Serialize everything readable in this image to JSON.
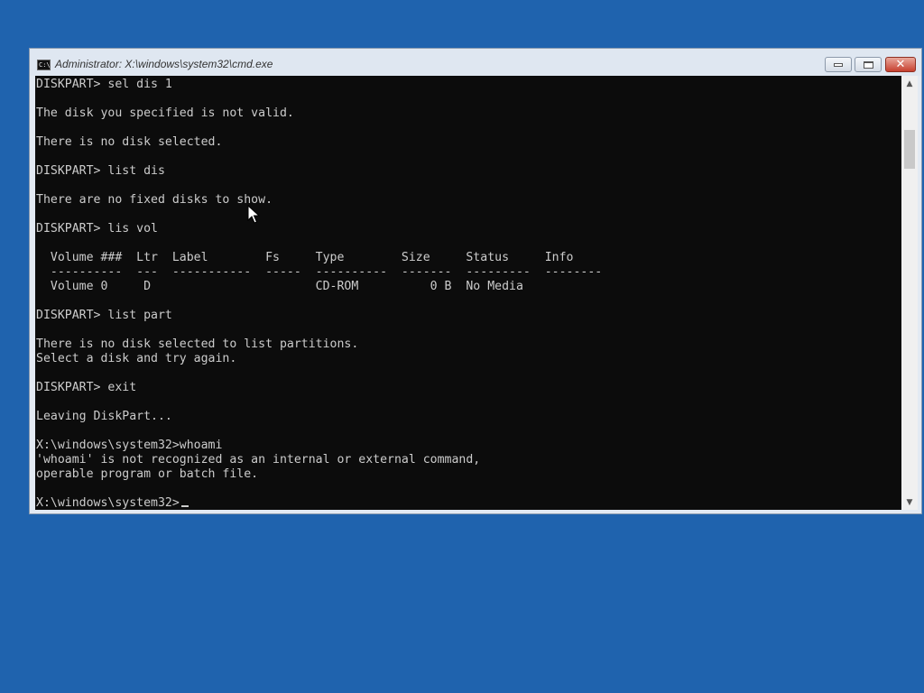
{
  "window": {
    "title": "Administrator: X:\\windows\\system32\\cmd.exe",
    "title_icon_text": "C:\\",
    "controls": {
      "minimize_icon": "minimize-icon",
      "maximize_icon": "maximize-icon",
      "close_icon": "close-icon",
      "close_glyph": "✕"
    }
  },
  "console": {
    "lines": [
      "DISKPART> sel dis 1",
      "",
      "The disk you specified is not valid.",
      "",
      "There is no disk selected.",
      "",
      "DISKPART> list dis",
      "",
      "There are no fixed disks to show.",
      "",
      "DISKPART> lis vol",
      "",
      "  Volume ###  Ltr  Label        Fs     Type        Size     Status     Info",
      "  ----------  ---  -----------  -----  ----------  -------  ---------  --------",
      "  Volume 0     D                       CD-ROM          0 B  No Media",
      "",
      "DISKPART> list part",
      "",
      "There is no disk selected to list partitions.",
      "Select a disk and try again.",
      "",
      "DISKPART> exit",
      "",
      "Leaving DiskPart...",
      "",
      "X:\\windows\\system32>whoami",
      "'whoami' is not recognized as an internal or external command,",
      "operable program or batch file.",
      "",
      "X:\\windows\\system32>"
    ]
  },
  "scrollbar": {
    "up_arrow": "▲",
    "down_arrow": "▼"
  },
  "colors": {
    "desktop": "#1f63ae",
    "console_bg": "#0c0c0c",
    "console_text": "#cccccc",
    "close_button": "#c7402f"
  }
}
